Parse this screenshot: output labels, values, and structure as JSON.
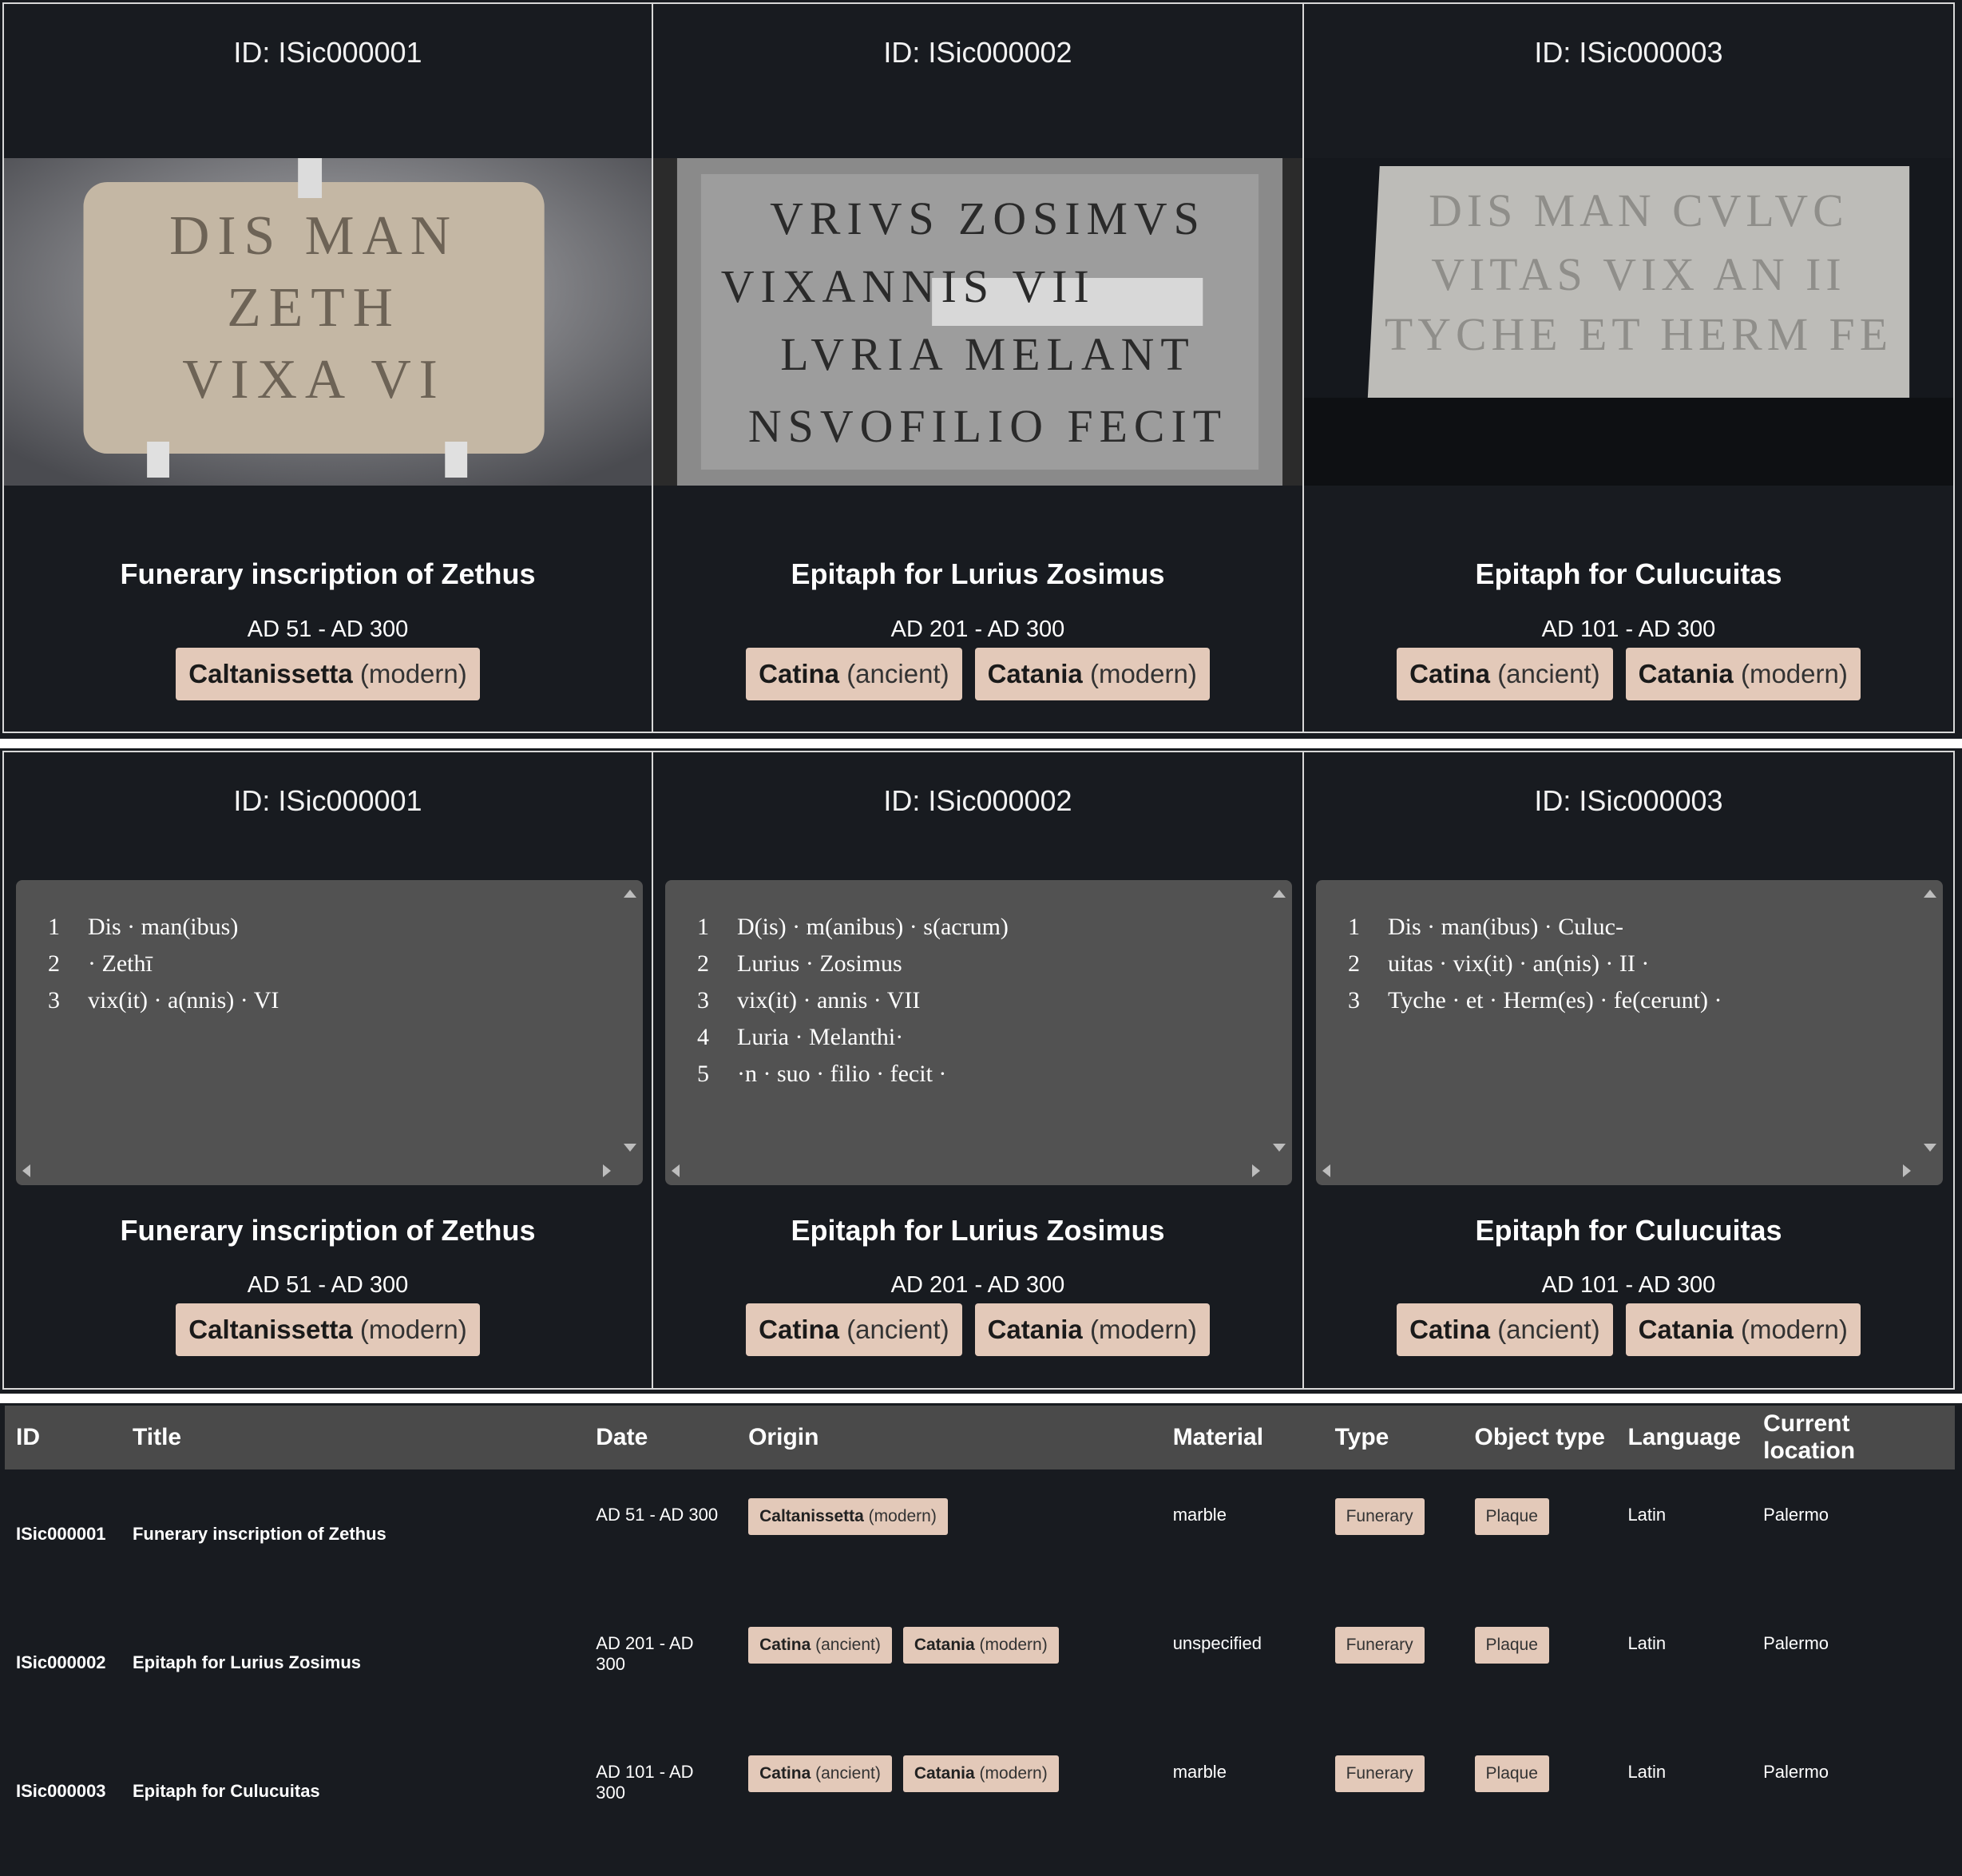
{
  "cards": [
    {
      "id_label": "ID: ISic000001",
      "title": "Funerary inscription of Zethus",
      "date": "AD 51 - AD 300",
      "places": [
        {
          "name": "Caltanissetta",
          "kind": "(modern)"
        }
      ],
      "text_lines": [
        "Dis · man(ibus)",
        "· Zethī",
        "vix(it) · a(nnis) · VI"
      ]
    },
    {
      "id_label": "ID: ISic000002",
      "title": "Epitaph for Lurius Zosimus",
      "date": "AD 201 - AD 300",
      "places": [
        {
          "name": "Catina",
          "kind": "(ancient)"
        },
        {
          "name": "Catania",
          "kind": "(modern)"
        }
      ],
      "text_lines": [
        "D(is) · m(anibus) · s(acrum)",
        "Lurius · Zosimus",
        "vix(it) · annis · VII",
        "Luria · Melanthi·",
        "·n · suo · filio · fecit ·"
      ]
    },
    {
      "id_label": "ID: ISic000003",
      "title": "Epitaph for Culucuitas",
      "date": "AD 101 - AD 300",
      "places": [
        {
          "name": "Catina",
          "kind": "(ancient)"
        },
        {
          "name": "Catania",
          "kind": "(modern)"
        }
      ],
      "text_lines": [
        "Dis · man(ibus) · Culuc-",
        "uitas · vix(it) · an(nis) · II ·",
        "Tyche · et · Herm(es) · fe(cerunt) ·"
      ]
    }
  ],
  "table": {
    "headers": [
      "ID",
      "Title",
      "Date",
      "Origin",
      "Material",
      "Type",
      "Object type",
      "Language",
      "Current location"
    ],
    "rows": [
      {
        "id": "ISic000001",
        "title": "Funerary inscription of Zethus",
        "date": "AD 51 - AD 300",
        "origin": [
          {
            "name": "Caltanissetta",
            "kind": "(modern)"
          }
        ],
        "material": "marble",
        "type": "Funerary",
        "object_type": "Plaque",
        "language": "Latin",
        "location": "Palermo"
      },
      {
        "id": "ISic000002",
        "title": "Epitaph for Lurius Zosimus",
        "date": "AD 201 - AD 300",
        "origin": [
          {
            "name": "Catina",
            "kind": "(ancient)"
          },
          {
            "name": "Catania",
            "kind": "(modern)"
          }
        ],
        "material": "unspecified",
        "type": "Funerary",
        "object_type": "Plaque",
        "language": "Latin",
        "location": "Palermo"
      },
      {
        "id": "ISic000003",
        "title": "Epitaph for Culucuitas",
        "date": "AD 101 - AD 300",
        "origin": [
          {
            "name": "Catina",
            "kind": "(ancient)"
          },
          {
            "name": "Catania",
            "kind": "(modern)"
          }
        ],
        "material": "marble",
        "type": "Funerary",
        "object_type": "Plaque",
        "language": "Latin",
        "location": "Palermo"
      }
    ]
  },
  "colors": {
    "background": "#181b20",
    "tag": "#e3c9b9",
    "text_panel": "#525252",
    "table_header": "#4a4a4a"
  },
  "photos": [
    "inscribed stone plaque photo",
    "inscribed stone fragment photo (black and white)",
    "inscribed stone block photo"
  ]
}
